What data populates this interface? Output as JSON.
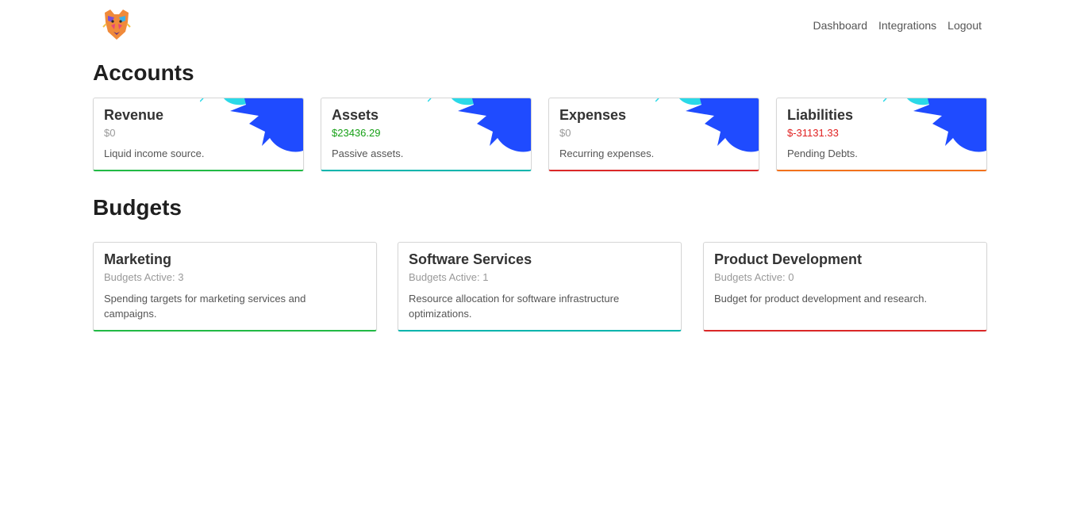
{
  "nav": {
    "dashboard": "Dashboard",
    "integrations": "Integrations",
    "logout": "Logout"
  },
  "accounts": {
    "title": "Accounts",
    "cards": [
      {
        "title": "Revenue",
        "value": "$0",
        "description": "Liquid income source.",
        "value_color": "#999999",
        "accent": "#21ba45"
      },
      {
        "title": "Assets",
        "value": "$23436.29",
        "description": "Passive assets.",
        "value_color": "#16a016",
        "accent": "#00b5ad"
      },
      {
        "title": "Expenses",
        "value": "$0",
        "description": "Recurring expenses.",
        "value_color": "#999999",
        "accent": "#db2828"
      },
      {
        "title": "Liabilities",
        "value": "$-31131.33",
        "description": "Pending Debts.",
        "value_color": "#e02020",
        "accent": "#f2711c"
      }
    ]
  },
  "budgets": {
    "title": "Budgets",
    "cards": [
      {
        "title": "Marketing",
        "value": "Budgets Active: 3",
        "description": "Spending targets for marketing services and campaigns.",
        "accent": "#21ba45"
      },
      {
        "title": "Software Services",
        "value": "Budgets Active: 1",
        "description": "Resource allocation for software infrastructure optimizations.",
        "accent": "#00b5ad"
      },
      {
        "title": "Product Development",
        "value": "Budgets Active: 0",
        "description": "Budget for product development and research.",
        "accent": "#db2828"
      }
    ]
  },
  "colors": {
    "deco_blue": "#1f4bff",
    "deco_cyan": "#2ad9e8"
  },
  "icons": {
    "logo": "tiger-logo-icon"
  }
}
